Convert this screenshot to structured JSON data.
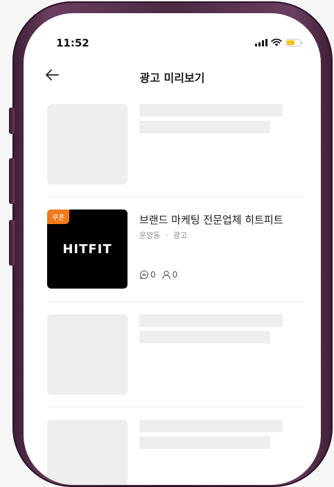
{
  "status_bar": {
    "time": "11:52"
  },
  "header": {
    "title": "광고 미리보기"
  },
  "ad_item": {
    "badge": "쿠폰",
    "brand": "HITFIT",
    "title": "브랜드 마케팅 전문업체 히트피트",
    "location": "운양동",
    "separator": "·",
    "type": "광고",
    "comment_count": "0",
    "like_count": "0"
  },
  "colors": {
    "coupon_badge": "#f07a1c",
    "battery": "#f4c21a",
    "placeholder": "#eeeeee",
    "frame": "#5a3250"
  }
}
